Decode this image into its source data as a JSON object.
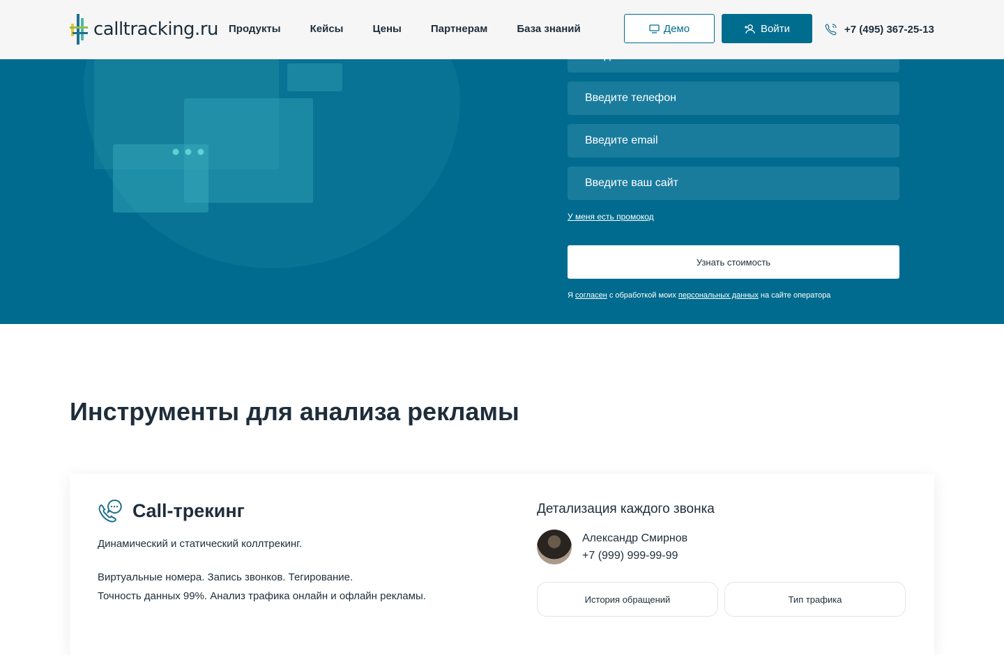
{
  "header": {
    "logo_text": "calltracking.ru",
    "nav": [
      "Продукты",
      "Кейсы",
      "Цены",
      "Партнерам",
      "База знаний"
    ],
    "demo_label": "Демо",
    "login_label": "Войти",
    "phone": "+7 (495) 367-25-13"
  },
  "form": {
    "name_placeholder": "Введите имя",
    "phone_placeholder": "Введите телефон",
    "email_placeholder": "Введите email",
    "site_placeholder": "Введите ваш сайт",
    "promo_link": "У меня есть промокод",
    "submit_label": "Узнать стоимость",
    "consent_prefix": "Я",
    "consent_link1": "согласен",
    "consent_middle": "с обработкой моих",
    "consent_link2": "персональных данных",
    "consent_suffix": "на сайте оператора"
  },
  "section": {
    "title": "Инструменты для анализа рекламы"
  },
  "card": {
    "title": "Call-трекинг",
    "line1": "Динамический и статический коллтрекинг.",
    "line2": "Виртуальные номера. Запись звонков. Тегирование.",
    "line3": "Точность данных 99%. Анализ трафика онлайн и офлайн рекламы.",
    "detail_title": "Детализация каждого звонка",
    "person_name": "Александр Смирнов",
    "person_phone": "+7 (999) 999-99-99",
    "pills": [
      "История обращений",
      "Тип трафика"
    ]
  },
  "colors": {
    "brand": "#006b8e",
    "field": "#1a7c9d",
    "text": "#1e2d3a"
  }
}
